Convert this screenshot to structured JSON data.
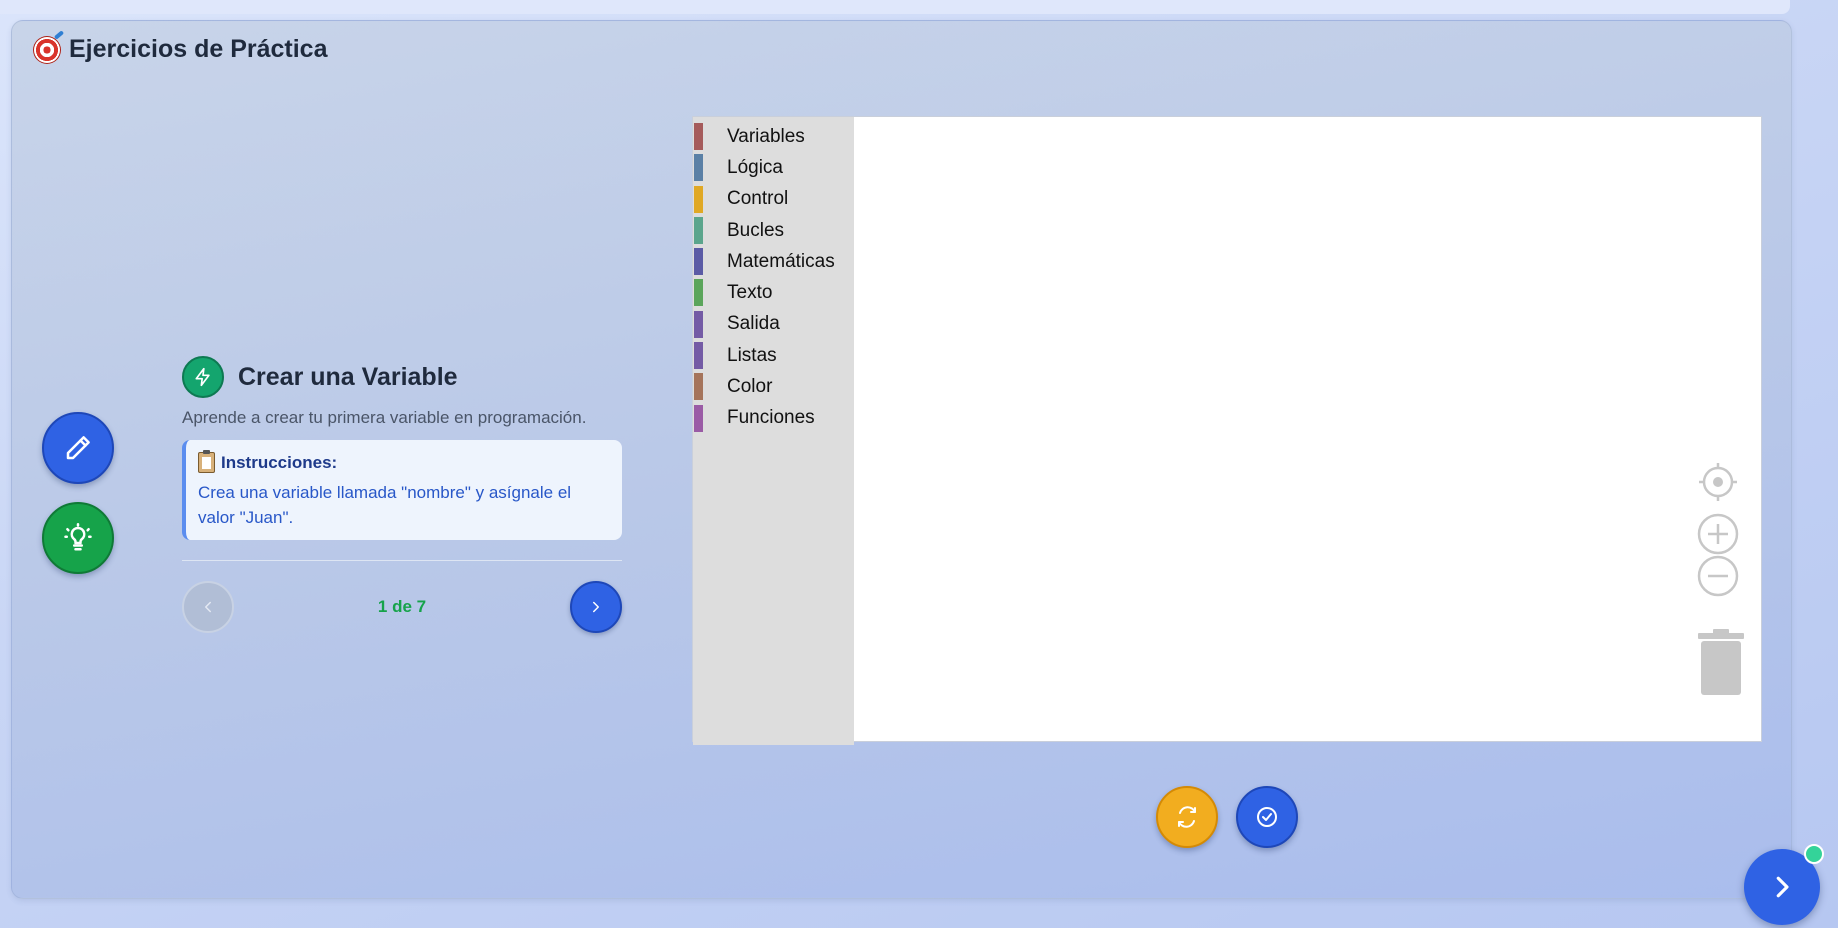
{
  "header": {
    "icon": "target-icon",
    "title": "Ejercicios de Práctica"
  },
  "side_buttons": [
    {
      "name": "edit-button",
      "icon": "pencil-icon",
      "color": "#2f62e4"
    },
    {
      "name": "hint-button",
      "icon": "lightbulb-icon",
      "color": "#16a34a"
    }
  ],
  "exercise": {
    "icon": "bolt-icon",
    "title": "Crear una Variable",
    "description": "Aprende a crear tu primera variable en programación.",
    "instructions_label": "Instrucciones:",
    "instructions_text": "Crea una variable llamada \"nombre\" y asígnale el valor \"Juan\".",
    "pager": {
      "current_text": "1 de 7"
    }
  },
  "toolbox": {
    "categories": [
      {
        "label": "Variables",
        "color": "#a55b5b"
      },
      {
        "label": "Lógica",
        "color": "#5b80a5"
      },
      {
        "label": "Control",
        "color": "#e0a824"
      },
      {
        "label": "Bucles",
        "color": "#5ba58c"
      },
      {
        "label": "Matemáticas",
        "color": "#5b5ba5"
      },
      {
        "label": "Texto",
        "color": "#5ba55b"
      },
      {
        "label": "Salida",
        "color": "#745ba5"
      },
      {
        "label": "Listas",
        "color": "#745ba5"
      },
      {
        "label": "Color",
        "color": "#a5745b"
      },
      {
        "label": "Funciones",
        "color": "#9a5ba5"
      }
    ]
  },
  "workspace_controls": [
    "recenter-icon",
    "zoom-in-icon",
    "zoom-out-icon",
    "trash-icon"
  ],
  "actions": [
    {
      "name": "reset-button",
      "icon": "refresh-icon",
      "color": "#f2ad1f"
    },
    {
      "name": "check-button",
      "icon": "check-circle-icon",
      "color": "#2f62e4"
    }
  ],
  "fab": {
    "icon": "chevron-right-icon",
    "status_color": "#34d399"
  }
}
